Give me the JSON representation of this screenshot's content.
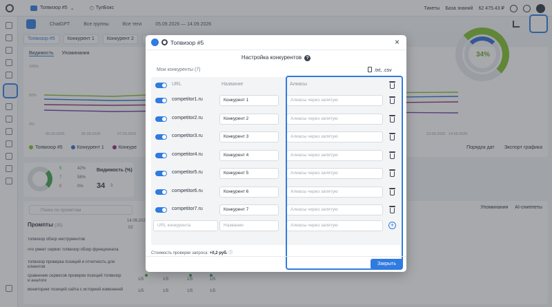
{
  "topbar": {
    "project": "Топвизор #5",
    "toolbox": "ТулБокс",
    "tickets": "Тикеты",
    "knowledge_base": "База знаний",
    "balance": "62 475.43 ₽"
  },
  "filters": {
    "model": "ChatGPT",
    "groups": "Все группы",
    "tags": "Все теги",
    "date_range": "05.09.2026 — 14.09.2026"
  },
  "project_tabs": [
    "Топвизор #5",
    "Конкурент 1",
    "Конкурент 2",
    "Ко"
  ],
  "chart": {
    "tabs": [
      "Видимость",
      "Упоминания"
    ],
    "y_ticks": [
      "100%",
      "50%",
      "0%"
    ],
    "x_ticks": [
      "05.09.2026",
      "06.09.2026",
      "07.09.2026",
      "13.09.2026",
      "14.09.2026"
    ],
    "legend": [
      "Топвизор #5",
      "Конкурент 1",
      "Конкуре"
    ],
    "donut_value": "34%",
    "sort_label": "Порядок дат",
    "export_label": "Экспорт графика"
  },
  "stats": {
    "title": "Видимость (%)",
    "value": "34",
    "delta": "3",
    "legend_values": [
      "5",
      "7",
      "0"
    ],
    "legend_pct": [
      "42%",
      "58%",
      "0%"
    ]
  },
  "prompts": {
    "search_placeholder": "Поиск по промптам",
    "title": "Промпты",
    "count": "(35)",
    "date_col": "14.09.2026",
    "date_col_sub": "02",
    "right_tabs": [
      "Упоминания",
      "AI-сниппеты"
    ],
    "rows": [
      "топвизор обзор инструментов",
      "что умеет сервис топвизор обзор функционала",
      "топвизор проверка позиций и отчетность для клиентов",
      "сравнение сервисов проверки позиций топвизор и аналоги",
      "мониторинг позиций сайта с историей изменений"
    ],
    "cell_value": "1/5"
  },
  "modal": {
    "title": "Топвизор #5",
    "section_title": "Настройка конкурентов",
    "my_competitors": "Мои конкуренты (7)",
    "file_types": ".txt, .csv",
    "col_url": "URL",
    "col_name": "Название",
    "col_aliases": "Алиасы",
    "alias_placeholder": "Алиасы через запятую",
    "competitors": [
      {
        "url": "competitor1.ru",
        "name": "Конкурент 1",
        "enabled": true
      },
      {
        "url": "competitor2.ru",
        "name": "Конкурент 2",
        "enabled": true
      },
      {
        "url": "competitor3.ru",
        "name": "Конкурент 3",
        "enabled": true
      },
      {
        "url": "competitor4.ru",
        "name": "Конкурент 4",
        "enabled": true
      },
      {
        "url": "competitor5.ru",
        "name": "Конкурент 5",
        "enabled": true
      },
      {
        "url": "competitor6.ru",
        "name": "Конкурент 6",
        "enabled": true
      },
      {
        "url": "competitor7.ru",
        "name": "Конкурент 7",
        "enabled": true
      }
    ],
    "new_row": {
      "url_placeholder": "URL конкурента",
      "name_placeholder": "Название",
      "alias_placeholder": "Алиасы через запятую"
    },
    "cost_label": "Стоимость проверки запроса:",
    "cost_value": "+0,2 руб.",
    "close_button": "Закрыть"
  },
  "colors": {
    "accent": "#2f7be0",
    "green": "#7fbf2a"
  }
}
